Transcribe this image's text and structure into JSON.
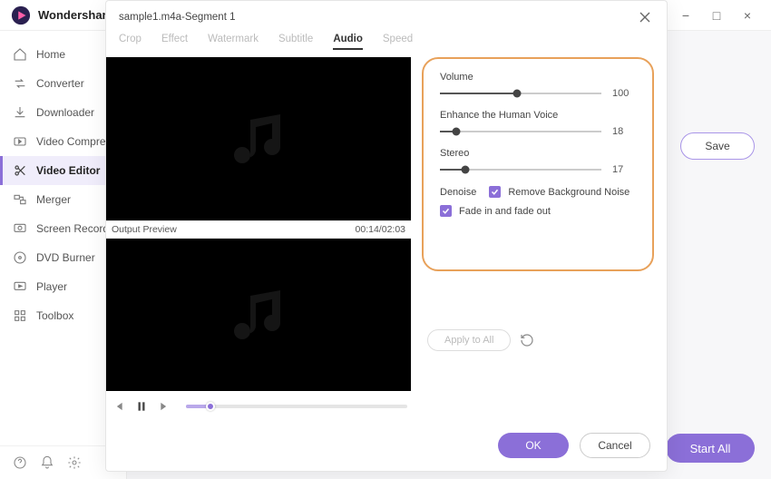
{
  "app": {
    "title": "Wondershare UniConverter"
  },
  "window_controls": {
    "menu": "≡",
    "min": "−",
    "max": "□",
    "close": "×"
  },
  "sidebar": {
    "items": [
      {
        "label": "Home",
        "icon": "home-icon"
      },
      {
        "label": "Converter",
        "icon": "converter-icon"
      },
      {
        "label": "Downloader",
        "icon": "downloader-icon"
      },
      {
        "label": "Video Compressor",
        "icon": "compressor-icon"
      },
      {
        "label": "Video Editor",
        "icon": "editor-icon",
        "active": true
      },
      {
        "label": "Merger",
        "icon": "merger-icon"
      },
      {
        "label": "Screen Recorder",
        "icon": "recorder-icon"
      },
      {
        "label": "DVD Burner",
        "icon": "dvd-icon"
      },
      {
        "label": "Player",
        "icon": "player-icon"
      },
      {
        "label": "Toolbox",
        "icon": "toolbox-icon"
      }
    ]
  },
  "content_bg": {
    "save_label": "Save",
    "start_all_label": "Start All"
  },
  "modal": {
    "title": "sample1.m4a-Segment 1",
    "tabs": [
      "Crop",
      "Effect",
      "Watermark",
      "Subtitle",
      "Audio",
      "Speed"
    ],
    "active_tab": "Audio",
    "preview": {
      "output_label": "Output Preview",
      "time": "00:14/02:03",
      "progress_pct": 11
    },
    "audio": {
      "volume": {
        "label": "Volume",
        "value": 100,
        "pct": 48
      },
      "enhance": {
        "label": "Enhance the Human Voice",
        "value": 18,
        "pct": 10
      },
      "stereo": {
        "label": "Stereo",
        "value": 17,
        "pct": 16
      },
      "denoise": {
        "label": "Denoise",
        "checkbox_label": "Remove Background Noise",
        "checked": true
      },
      "fade": {
        "label": "Fade in and fade out",
        "checked": true
      }
    },
    "apply_all": "Apply to All",
    "ok": "OK",
    "cancel": "Cancel"
  }
}
